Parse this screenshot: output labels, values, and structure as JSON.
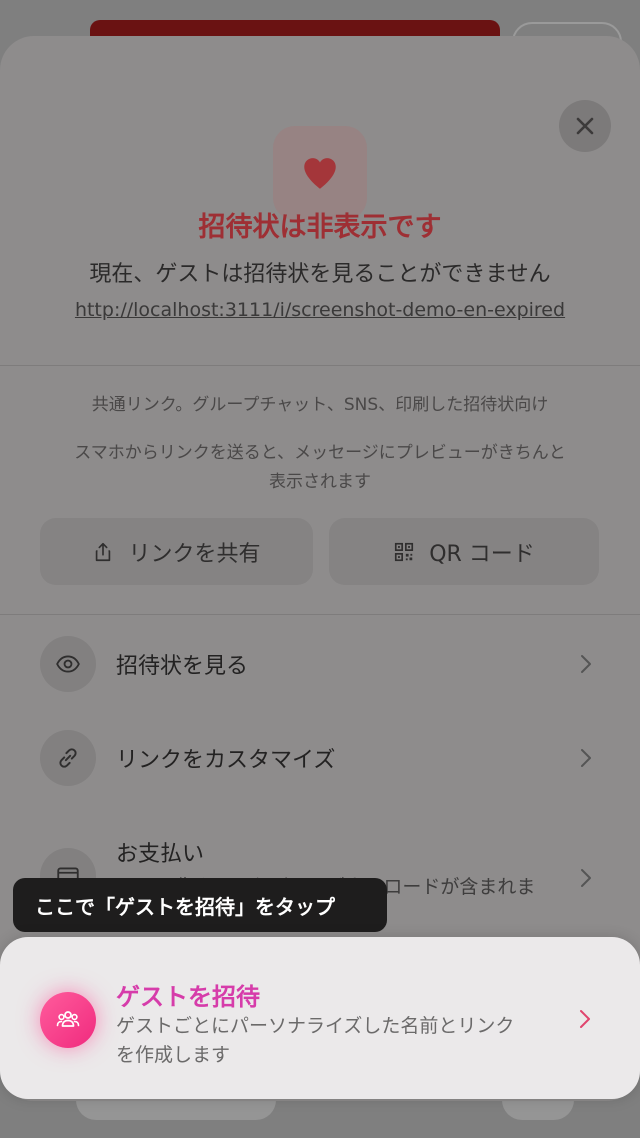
{
  "status": {
    "title": "招待状は非表示です",
    "subtitle": "現在、ゲストは招待状を見ることができません",
    "url": "http://localhost:3111/i/screenshot-demo-en-expired"
  },
  "share": {
    "description1": "共通リンク。グループチャット、SNS、印刷した招待状向け",
    "description2_line1": "スマホからリンクを送ると、メッセージにプレビューがきちんと",
    "description2_line2": "表示されます",
    "share_link_label": "リンクを共有",
    "qr_label": "QR コード"
  },
  "menu": {
    "view_invitation": "招待状を見る",
    "customize_link": "リンクをカスタマイズ",
    "payment_title": "お支払い",
    "payment_desc_partial": "PNG画像やPDF印刷用のダウンロードが含まれま"
  },
  "tooltip": {
    "text": "ここで「ゲストを招待」をタップ"
  },
  "invite_card": {
    "title": "ゲストを招待",
    "description_line1": "ゲストごとにパーソナライズした名前とリンク",
    "description_line2": "を作成します"
  },
  "colors": {
    "accent_pink": "#d63caa",
    "title_red": "#9e2f34",
    "icon_gradient_start": "#ff5c9c",
    "icon_gradient_end": "#f02a7e"
  },
  "icons": {
    "close": "close-icon",
    "heart": "heart-icon",
    "share": "share-icon",
    "qr": "qr-code-icon",
    "eye": "eye-icon",
    "link": "link-icon",
    "card": "card-icon",
    "people": "people-icon",
    "chevron": "chevron-right-icon"
  }
}
